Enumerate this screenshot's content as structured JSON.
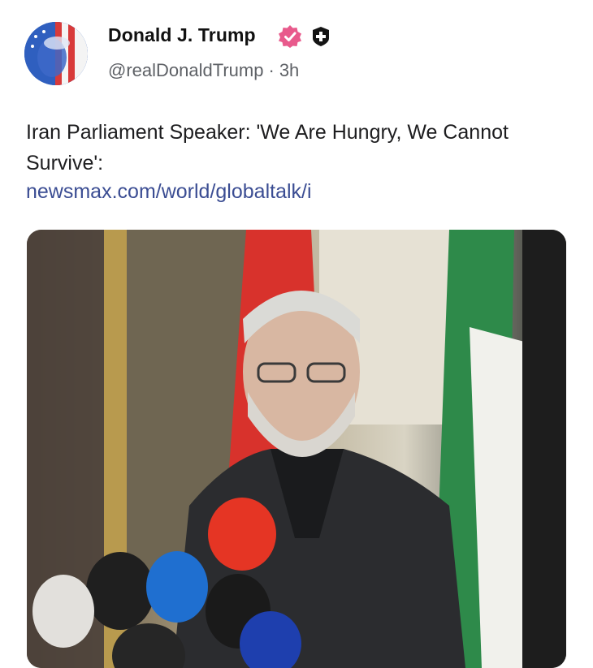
{
  "post": {
    "author_name": "Donald J. Trump",
    "handle": "@realDonaldTrump",
    "separator": "·",
    "time": "3h",
    "text": "Iran Parliament Speaker: 'We Are Hungry, We Cannot Survive':",
    "link": "newsmax.com/world/globaltalk/i"
  },
  "badges": {
    "verified_color": "#e85a8c",
    "plus_color": "#141414"
  },
  "icons": [
    "avatar-image",
    "verified-badge-icon",
    "plus-badge-icon"
  ],
  "media": {
    "kind": "photo"
  },
  "colors": {
    "link": "#3b4d93",
    "handle": "#5e6166",
    "text": "#1d1d1f"
  }
}
